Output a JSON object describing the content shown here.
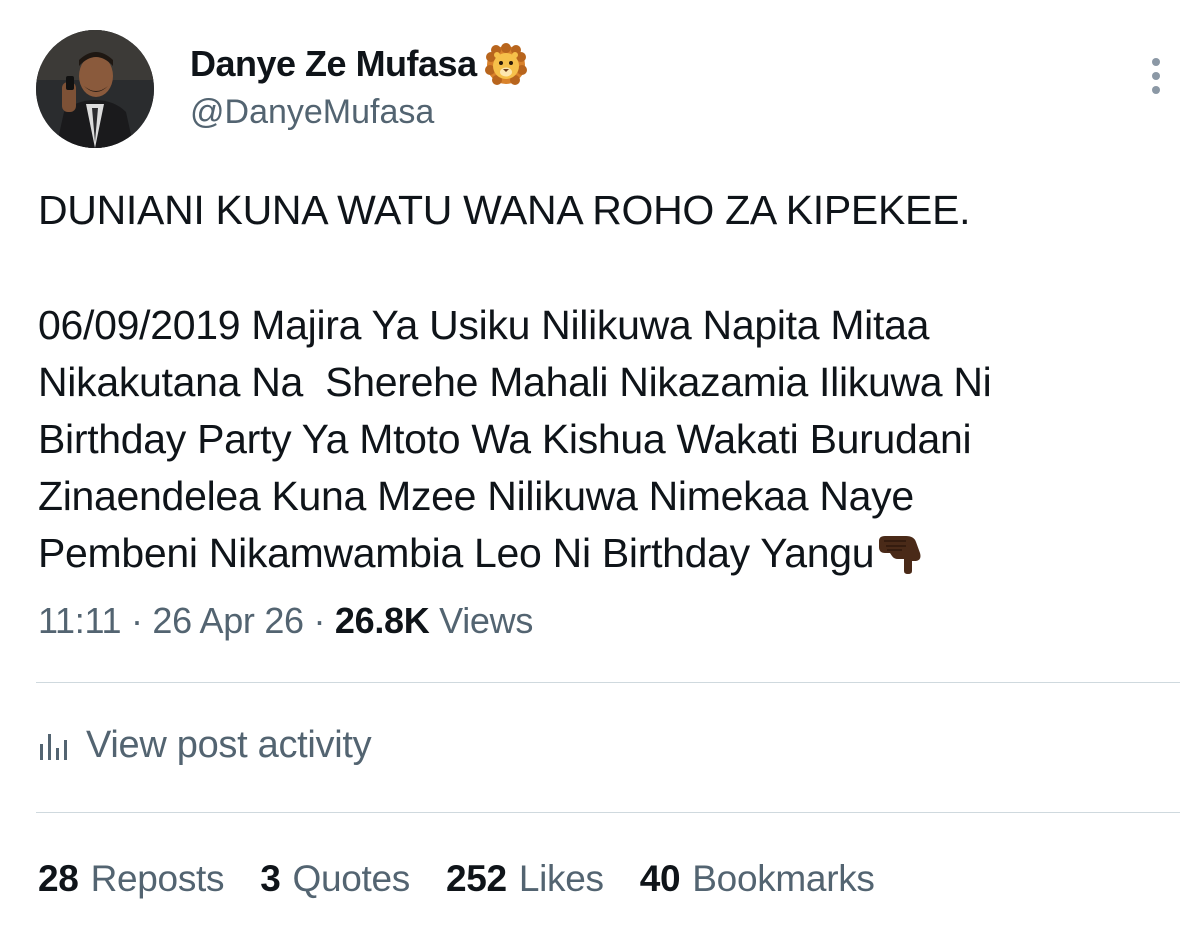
{
  "author": {
    "display_name": "Danye Ze Mufasa",
    "handle": "@DanyeMufasa",
    "badge_icon": "lion-face-icon"
  },
  "post": {
    "lines": [
      "DUNIANI KUNA WATU WANA ROHO ZA KIPEKEE.",
      "",
      "06/09/2019 Majira Ya Usiku Nilikuwa Napita Mitaa",
      "Nikakutana Na  Sherehe Mahali Nikazamia Ilikuwa Ni",
      "Birthday Party Ya Mtoto Wa Kishua Wakati Burudani",
      "Zinaendelea Kuna Mzee Nilikuwa Nimekaa Naye",
      "Pembeni Nikamwambia Leo Ni Birthday Yangu"
    ],
    "trailing_emoji": "pointing-down-icon"
  },
  "meta": {
    "time": "11:11",
    "sep1": " · ",
    "date": "26 Apr 26",
    "sep2": " · ",
    "views_count": "26.8K",
    "views_label": " Views"
  },
  "activity": {
    "label": "View post activity",
    "icon": "bar-chart-icon"
  },
  "stats": {
    "reposts": {
      "count": "28",
      "label": "Reposts"
    },
    "quotes": {
      "count": "3",
      "label": "Quotes"
    },
    "likes": {
      "count": "252",
      "label": "Likes"
    },
    "bookmarks": {
      "count": "40",
      "label": "Bookmarks"
    }
  },
  "colors": {
    "text_primary": "#0f1419",
    "text_secondary": "#536471",
    "divider": "#cfd9de"
  }
}
